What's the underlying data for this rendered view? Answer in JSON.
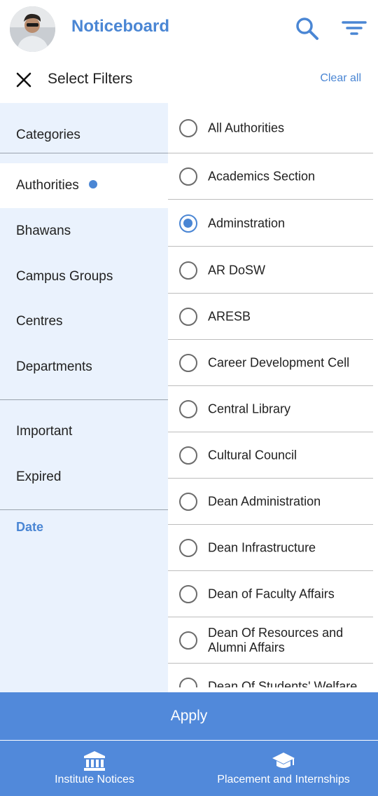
{
  "header": {
    "title": "Noticeboard",
    "avatar_icon": "user-avatar",
    "search_icon": "search-icon",
    "filter_icon": "filter-lines-icon",
    "accent_color": "#4a86d4"
  },
  "filters": {
    "title": "Select Filters",
    "clear_all": "Clear all"
  },
  "categories": {
    "group1": [
      "Categories",
      "Authorities",
      "Bhawans",
      "Campus Groups",
      "Centres",
      "Departments"
    ],
    "group2": [
      "Important",
      "Expired"
    ],
    "date": "Date",
    "active": "Authorities"
  },
  "options": [
    {
      "label": "All Authorities",
      "selected": false
    },
    {
      "label": "Academics Section",
      "selected": false
    },
    {
      "label": "Adminstration",
      "selected": true
    },
    {
      "label": "AR DoSW",
      "selected": false
    },
    {
      "label": "ARESB",
      "selected": false
    },
    {
      "label": "Career Development Cell",
      "selected": false
    },
    {
      "label": "Central Library",
      "selected": false
    },
    {
      "label": "Cultural Council",
      "selected": false
    },
    {
      "label": "Dean Administration",
      "selected": false
    },
    {
      "label": "Dean Infrastructure",
      "selected": false
    },
    {
      "label": "Dean of Faculty Affairs",
      "selected": false
    },
    {
      "label": "Dean Of Resources and Alumni Affairs",
      "selected": false
    },
    {
      "label": "Dean Of Students' Welfare",
      "selected": false
    }
  ],
  "apply_label": "Apply",
  "nav": [
    {
      "label": "Institute Notices",
      "icon": "bank-icon"
    },
    {
      "label": "Placement and Internships",
      "icon": "graduation-cap-icon"
    }
  ]
}
